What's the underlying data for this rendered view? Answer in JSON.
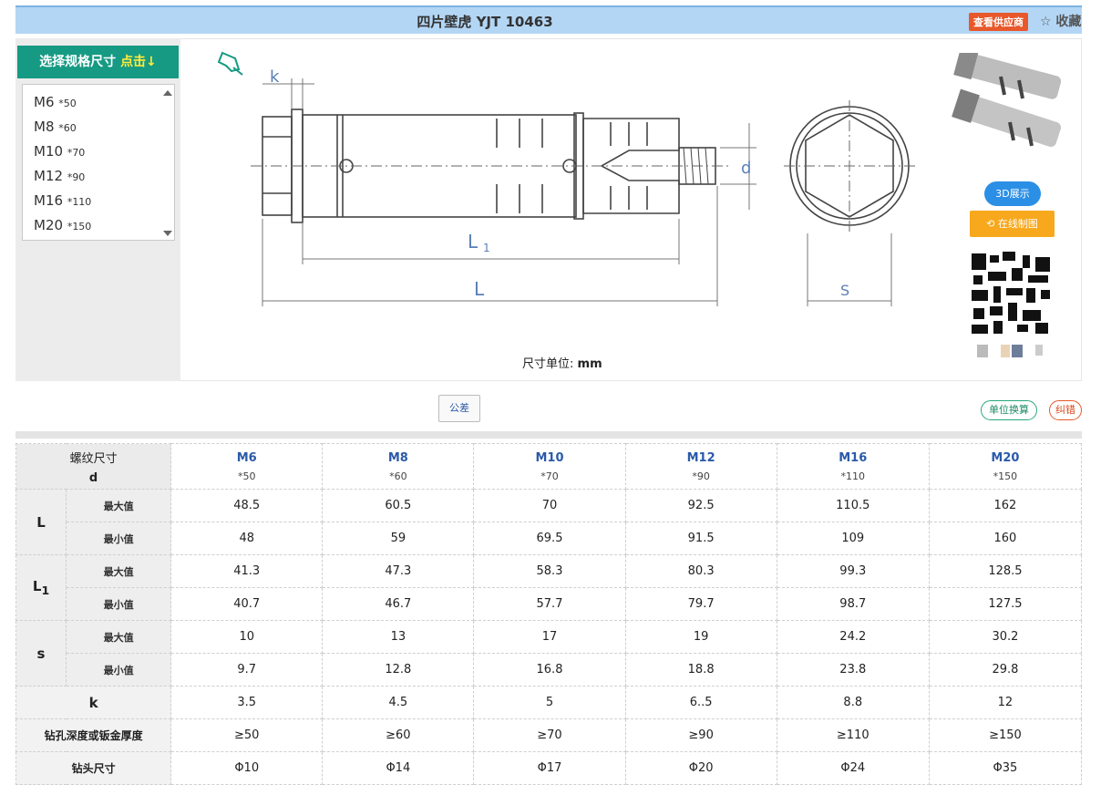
{
  "header": {
    "title": "四片壁虎 YJT 10463",
    "supplier_label": "查看供应商",
    "favorite_label": "☆ 收藏"
  },
  "size_selector": {
    "header_label": "选择规格尺寸",
    "header_hint": "点击↓",
    "items": [
      {
        "size": "M6",
        "length": "*50"
      },
      {
        "size": "M8",
        "length": "*60"
      },
      {
        "size": "M10",
        "length": "*70"
      },
      {
        "size": "M12",
        "length": "*90"
      },
      {
        "size": "M16",
        "length": "*110"
      },
      {
        "size": "M20",
        "length": "*150"
      }
    ]
  },
  "drawing": {
    "labels": {
      "k": "k",
      "d": "d",
      "L1": "L",
      "L1_sub": "1",
      "L": "L",
      "s": "S"
    },
    "unit_label": "尺寸单位:",
    "unit_value": "mm"
  },
  "actions": {
    "btn_3d": "3D展示",
    "btn_online": "在线制图",
    "tolerance": "公差",
    "unit_convert": "单位换算",
    "report_error": "纠错"
  },
  "table": {
    "header_label": "螺纹尺寸",
    "header_sub": "d",
    "columns": [
      {
        "size": "M6",
        "length": "*50"
      },
      {
        "size": "M8",
        "length": "*60"
      },
      {
        "size": "M10",
        "length": "*70"
      },
      {
        "size": "M12",
        "length": "*90"
      },
      {
        "size": "M16",
        "length": "*110"
      },
      {
        "size": "M20",
        "length": "*150"
      }
    ],
    "groups": [
      {
        "name": "L",
        "rows": [
          {
            "label": "最大值",
            "values": [
              "48.5",
              "60.5",
              "70",
              "92.5",
              "110.5",
              "162"
            ]
          },
          {
            "label": "最小值",
            "values": [
              "48",
              "59",
              "69.5",
              "91.5",
              "109",
              "160"
            ]
          }
        ]
      },
      {
        "name": "L",
        "sub": "1",
        "rows": [
          {
            "label": "最大值",
            "values": [
              "41.3",
              "47.3",
              "58.3",
              "80.3",
              "99.3",
              "128.5"
            ]
          },
          {
            "label": "最小值",
            "values": [
              "40.7",
              "46.7",
              "57.7",
              "79.7",
              "98.7",
              "127.5"
            ]
          }
        ]
      },
      {
        "name": "s",
        "rows": [
          {
            "label": "最大值",
            "values": [
              "10",
              "13",
              "17",
              "19",
              "24.2",
              "30.2"
            ]
          },
          {
            "label": "最小值",
            "values": [
              "9.7",
              "12.8",
              "16.8",
              "18.8",
              "23.8",
              "29.8"
            ]
          }
        ]
      }
    ],
    "single_rows": [
      {
        "label": "k",
        "values": [
          "3.5",
          "4.5",
          "5",
          "6..5",
          "8.8",
          "12"
        ]
      },
      {
        "label": "钻孔深度或钣金厚度",
        "values": [
          "≥50",
          "≥60",
          "≥70",
          "≥90",
          "≥110",
          "≥150"
        ]
      },
      {
        "label": "钻头尺寸",
        "values": [
          "Φ10",
          "Φ14",
          "Φ17",
          "Φ20",
          "Φ24",
          "Φ35"
        ]
      }
    ]
  }
}
